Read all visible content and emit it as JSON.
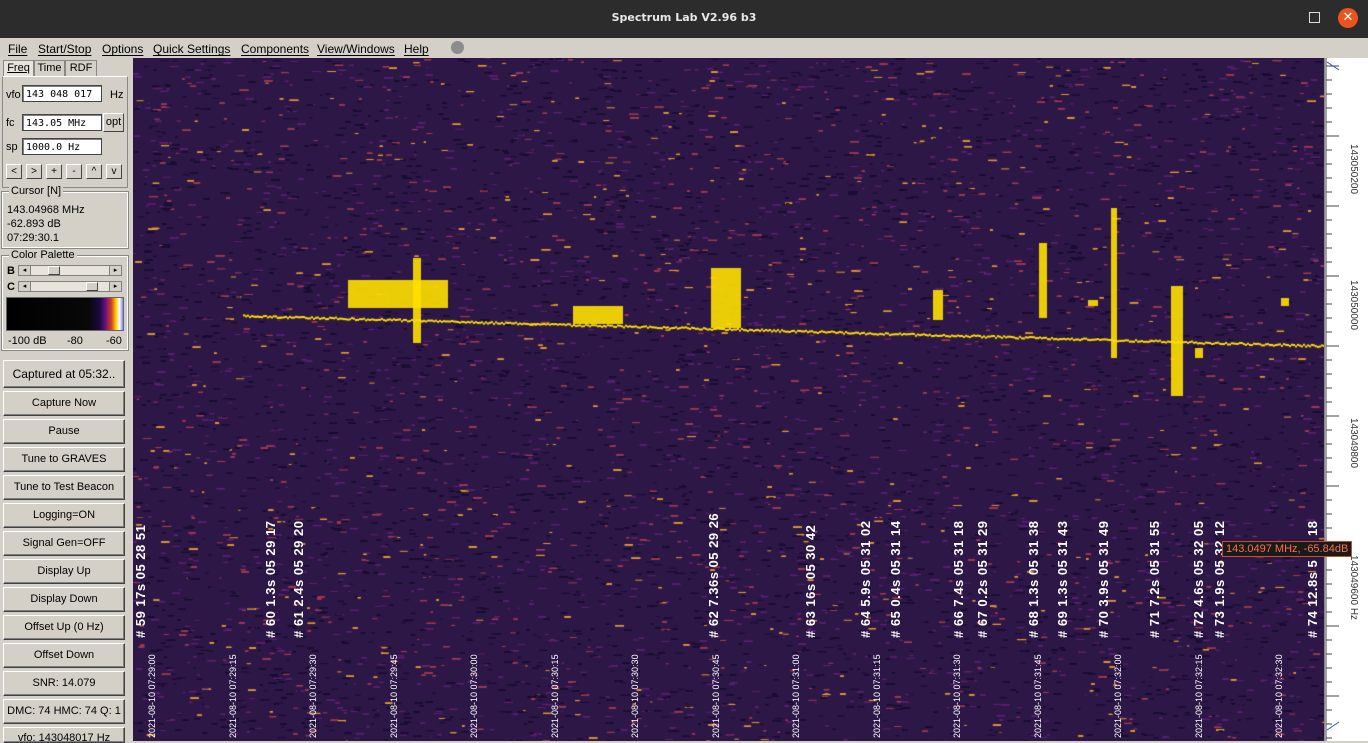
{
  "window": {
    "title": "Spectrum Lab V2.96 b3"
  },
  "menu": [
    "File",
    "Start/Stop",
    "Options",
    "Quick Settings",
    "Components",
    "View/Windows",
    "Help"
  ],
  "tabs": [
    "Freq",
    "Time",
    "RDF"
  ],
  "freq": {
    "vfo_label": "vfo",
    "vfo_value": "143 048 017",
    "vfo_unit": "Hz",
    "fc_label": "fc",
    "fc_value": "143.05 MHz",
    "opt_label": "opt",
    "sp_label": "sp",
    "sp_value": "1000.0 Hz",
    "nav": [
      "<",
      ">",
      "+",
      "-",
      "^",
      "v"
    ]
  },
  "cursor": {
    "title": "Cursor [N]",
    "freq": "143.04968 MHz",
    "level": "-62.893 dB",
    "time": "07:29:30.1"
  },
  "palette": {
    "title": "Color Palette",
    "b_label": "B",
    "c_label": "C",
    "b_level": 0.25,
    "c_level": 0.8,
    "scale": [
      "-100 dB",
      "-80",
      "-60"
    ]
  },
  "buttons": {
    "captured": "Captured at 05:32..",
    "capture_now": "Capture Now",
    "pause": "Pause",
    "tune_graves": "Tune to GRAVES",
    "tune_beacon": "Tune to Test Beacon",
    "logging": "Logging=ON",
    "signal_gen": "Signal Gen=OFF",
    "display_up": "Display Up",
    "display_down": "Display Down",
    "offset_up": "Offset Up (0 Hz)",
    "offset_down": "Offset Down",
    "snr": "SNR: 14.079",
    "dmc": "DMC: 74 HMC: 74 Q: 1",
    "vfo_status": "vfo: 143048017 Hz"
  },
  "marker": "143.0497 MHz, -65.84dB",
  "scale_labels": [
    "143050200",
    "143050000",
    "143049800",
    "143049600 Hz"
  ],
  "timestamps": [
    "2021-08-10 07:29:00",
    "2021-08-10 07:29:15",
    "2021-08-10 07:29:30",
    "2021-08-10 07:29:45",
    "2021-08-10 07:30:00",
    "2021-08-10 07:30:15",
    "2021-08-10 07:30:30",
    "2021-08-10 07:30:45",
    "2021-08-10 07:31:00",
    "2021-08-10 07:31:15",
    "2021-08-10 07:31:30",
    "2021-08-10 07:31:45",
    "2021-08-10 07:32:00",
    "2021-08-10 07:32:15",
    "2021-08-10 07:32:30"
  ],
  "detections": [
    "# 59  17s  05 28 51",
    "# 60  1.3s  05 29 17",
    "# 61  2.4s  05 29 20",
    "# 62  7.36s  05 29 26",
    "# 63  16s  05 30 42",
    "# 64  5.9s  05 31 02",
    "# 65  0.4s  05 31 14",
    "# 66  7.4s  05 31 18",
    "# 67  0.2s  05 31 29",
    "# 68  1.3s  05 31 38",
    "# 69  1.3s  05 31 43",
    "# 70  3.9s  05 31 49",
    "# 71  7.2s  05 31 55",
    "# 72  4.6s  05 32 05",
    "# 73  1.9s  05 32 12",
    "# 74  12.8s  5 32 18"
  ],
  "colors": {
    "waterfall_bg": "#2d1747",
    "signal": "#ffe000",
    "noise": "#e0a030",
    "close": "#e95420"
  }
}
